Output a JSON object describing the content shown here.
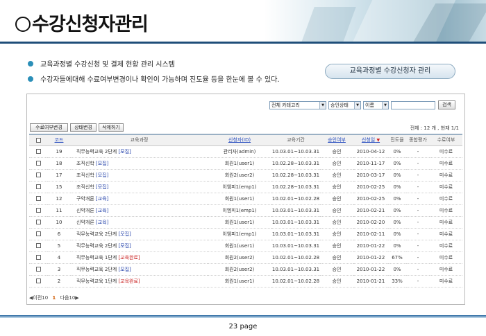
{
  "header": {
    "title": "수강신청자관리"
  },
  "bullets": [
    "교육과정별 수강신청 및 결제 현황 관리 시스템",
    "수강자들에대해 수료여부변경이나 확인이 가능하며 진도율 등을 한눈에 볼 수 있다."
  ],
  "pill_label": "교육과정별 수강신청자 관리",
  "search": {
    "category": "전체 카테고리",
    "status": "승인상태",
    "field": "이름",
    "button": "검색"
  },
  "actions": {
    "complete": "수료여부변경",
    "status": "상태변경",
    "delete": "삭제하기"
  },
  "total": "전체 : 12 개 , 현재 1/1",
  "columns": [
    "코드",
    "교육과정",
    "신청자(ID)",
    "교육기간",
    "승인여부",
    "신청일",
    "진도율",
    "종합평가",
    "수료여부"
  ],
  "rows": [
    {
      "code": "19",
      "course": "직무능력교육 2단계",
      "tag": "[모집]",
      "tag_type": "b",
      "user": "관리자(admin)",
      "period": "10.03.01~10.03.31",
      "approved": "승인",
      "date": "2010-04-12",
      "progress": "0%",
      "eval": "-",
      "done": "미수료"
    },
    {
      "code": "18",
      "course": "조직신학",
      "tag": "[모집]",
      "tag_type": "b",
      "user": "회원1(user1)",
      "period": "10.02.28~10.03.31",
      "approved": "승인",
      "date": "2010-11-17",
      "progress": "0%",
      "eval": "-",
      "done": "미수료"
    },
    {
      "code": "17",
      "course": "조직신학",
      "tag": "[모집]",
      "tag_type": "b",
      "user": "회원2(user2)",
      "period": "10.02.28~10.03.31",
      "approved": "승인",
      "date": "2010-03-17",
      "progress": "0%",
      "eval": "-",
      "done": "미수료"
    },
    {
      "code": "15",
      "course": "조직신학",
      "tag": "[모집]",
      "tag_type": "b",
      "user": "이엠피1(emp1)",
      "period": "10.02.28~10.03.31",
      "approved": "승인",
      "date": "2010-02-25",
      "progress": "0%",
      "eval": "-",
      "done": "미수료"
    },
    {
      "code": "12",
      "course": "구약개론",
      "tag": "[교육]",
      "tag_type": "b",
      "user": "회원1(user1)",
      "period": "10.02.01~10.02.28",
      "approved": "승인",
      "date": "2010-02-25",
      "progress": "0%",
      "eval": "-",
      "done": "미수료"
    },
    {
      "code": "11",
      "course": "신약개론",
      "tag": "[교육]",
      "tag_type": "b",
      "user": "이엠피1(emp1)",
      "period": "10.03.01~10.03.31",
      "approved": "승인",
      "date": "2010-02-21",
      "progress": "0%",
      "eval": "-",
      "done": "미수료"
    },
    {
      "code": "10",
      "course": "신약개론",
      "tag": "[교육]",
      "tag_type": "b",
      "user": "회원1(user1)",
      "period": "10.03.01~10.03.31",
      "approved": "승인",
      "date": "2010-02-20",
      "progress": "0%",
      "eval": "-",
      "done": "미수료"
    },
    {
      "code": "6",
      "course": "직무능력교육 2단계",
      "tag": "[모집]",
      "tag_type": "b",
      "user": "이엠피1(emp1)",
      "period": "10.03.01~10.03.31",
      "approved": "승인",
      "date": "2010-02-11",
      "progress": "0%",
      "eval": "-",
      "done": "미수료"
    },
    {
      "code": "5",
      "course": "직무능력교육 2단계",
      "tag": "[모집]",
      "tag_type": "b",
      "user": "회원1(user1)",
      "period": "10.03.01~10.03.31",
      "approved": "승인",
      "date": "2010-01-22",
      "progress": "0%",
      "eval": "-",
      "done": "미수료"
    },
    {
      "code": "4",
      "course": "직무능력교육 1단계",
      "tag": "[교육완료]",
      "tag_type": "r",
      "user": "회원2(user2)",
      "period": "10.02.01~10.02.28",
      "approved": "승인",
      "date": "2010-01-22",
      "progress": "67%",
      "eval": "-",
      "done": "미수료"
    },
    {
      "code": "3",
      "course": "직무능력교육 2단계",
      "tag": "[모집]",
      "tag_type": "b",
      "user": "회원2(user2)",
      "period": "10.03.01~10.03.31",
      "approved": "승인",
      "date": "2010-01-22",
      "progress": "0%",
      "eval": "-",
      "done": "미수료"
    },
    {
      "code": "2",
      "course": "직무능력교육 1단계",
      "tag": "[교육완료]",
      "tag_type": "r",
      "user": "회원1(user1)",
      "period": "10.02.01~10.02.28",
      "approved": "승인",
      "date": "2010-01-21",
      "progress": "33%",
      "eval": "-",
      "done": "미수료"
    }
  ],
  "pager": {
    "prev": "◀이전10",
    "current": "1",
    "next": "다음10▶"
  },
  "page_label": "23 page"
}
